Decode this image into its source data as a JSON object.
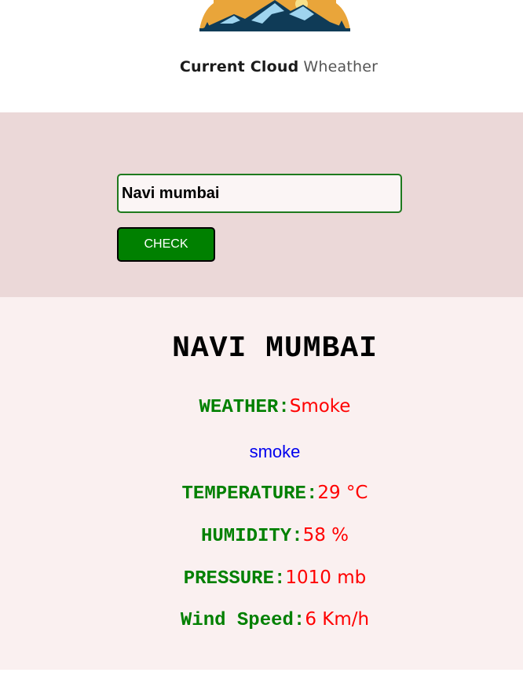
{
  "brand": {
    "name_bold": "Current Cloud",
    "name_light": "Wheather"
  },
  "search": {
    "input_value": "Navi mumbai",
    "button_label": "CHECK"
  },
  "result": {
    "city": "NAVI MUMBAI",
    "weather_label": "WEATHER:",
    "weather_value": "Smoke",
    "description": "smoke",
    "temperature_label": "TEMPERATURE:",
    "temperature_value": "29 °C",
    "humidity_label": "HUMIDITY:",
    "humidity_value": "58 %",
    "pressure_label": "PRESSURE:",
    "pressure_value": "1010 mb",
    "wind_label": "Wind Speed:",
    "wind_value": "6 Km/h"
  },
  "colors": {
    "accent_green": "#008000",
    "value_red": "#ff0000",
    "description_blue": "#0000ee",
    "search_band_bg": "#ebd8d8",
    "result_bg": "#faf0f0"
  },
  "icons": {
    "logo": "mountain-sun-logo-icon"
  }
}
